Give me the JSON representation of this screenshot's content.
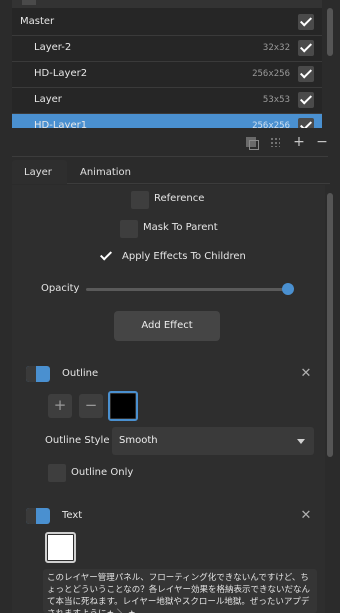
{
  "layers": [
    {
      "name": "Master",
      "size": "",
      "checked": true,
      "selected": false,
      "indent": false
    },
    {
      "name": "Layer-2",
      "size": "32x32",
      "checked": true,
      "selected": false,
      "indent": true
    },
    {
      "name": "HD-Layer2",
      "size": "256x256",
      "checked": true,
      "selected": false,
      "indent": true
    },
    {
      "name": "Layer",
      "size": "53x53",
      "checked": true,
      "selected": false,
      "indent": true
    },
    {
      "name": "HD-Layer1",
      "size": "256x256",
      "checked": true,
      "selected": true,
      "indent": true
    }
  ],
  "list_toolbar": {
    "duplicate_icon": "duplicate-icon",
    "move_icon": "move-icon",
    "add_label": "+",
    "remove_label": "−"
  },
  "tabs": [
    {
      "label": "Layer",
      "active": true
    },
    {
      "label": "Animation",
      "active": false
    }
  ],
  "layer_props": {
    "reference_label": "Reference",
    "reference_checked": false,
    "mask_label": "Mask To Parent",
    "mask_checked": false,
    "apply_effects_label": "Apply Effects To Children",
    "apply_effects_checked": true,
    "opacity_label": "Opacity",
    "opacity_value": 1.0,
    "add_effect_label": "Add Effect"
  },
  "effects": {
    "outline": {
      "title": "Outline",
      "add_label": "+",
      "remove_label": "−",
      "color": "#000000",
      "style_label": "Outline Style",
      "style_value": "Smooth",
      "only_label": "Outline Only",
      "only_checked": false
    },
    "text": {
      "title": "Text",
      "color": "#ffffff",
      "content": "このレイヤー管理パネル、フローティング化できないんですけど、ちょっとどういうことなの？各レイヤー効果を格納表示できないだなんて本当に死ねます。レイヤー地獄やスクロール地獄。ぜったいアプデされますように★ ＼ ★"
    }
  },
  "colors": {
    "accent": "#4a90d0",
    "background": "#2b2b2b",
    "panel": "#2e2e2e"
  }
}
